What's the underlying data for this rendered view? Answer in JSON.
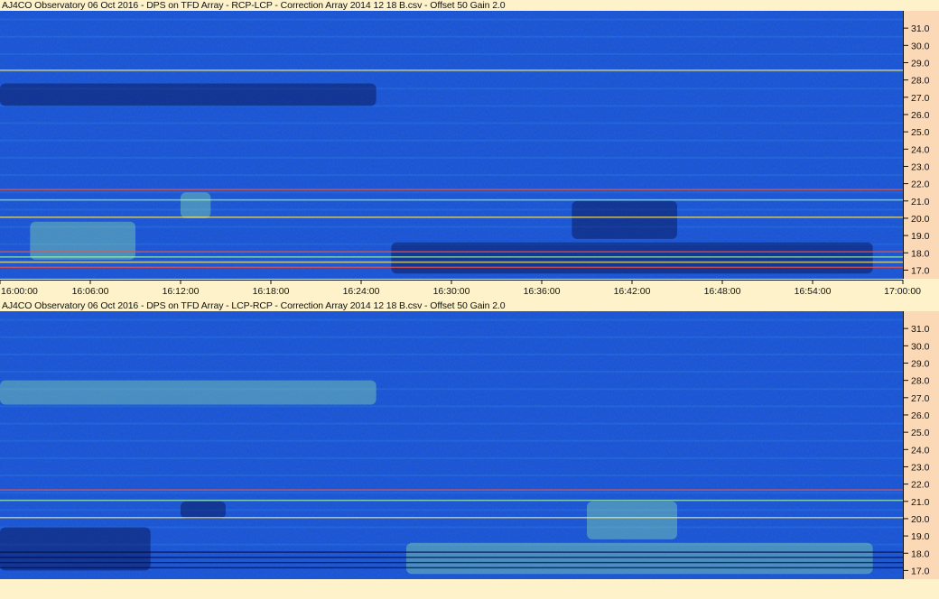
{
  "chart_data": [
    {
      "type": "heatmap",
      "title": "AJ4CO Observatory 06 Oct 2016 - DPS on TFD Array - RCP-LCP - Correction Array 2014 12 18 B.csv - Offset 50  Gain 2.0",
      "x_tick_labels": [
        "16:00:00",
        "16:06:00",
        "16:12:00",
        "16:18:00",
        "16:24:00",
        "16:30:00",
        "16:36:00",
        "16:42:00",
        "16:48:00",
        "16:54:00",
        "17:00:00"
      ],
      "y_tick_labels": [
        "17.0",
        "18.0",
        "19.0",
        "20.0",
        "21.0",
        "22.0",
        "23.0",
        "24.0",
        "25.0",
        "26.0",
        "27.0",
        "28.0",
        "29.0",
        "30.0",
        "31.0"
      ],
      "xlim": [
        "16:00:00",
        "17:00:00"
      ],
      "ylim": [
        16.5,
        32.0
      ],
      "colormap": [
        "#07104a",
        "#1a55d8",
        "#3fa0f0",
        "#9ef7a0",
        "#ffe860",
        "#ff5030"
      ],
      "dark_regions": [
        {
          "t_start": "16:00:00",
          "t_end": "16:25:00",
          "f_low": 26.5,
          "f_high": 27.8
        },
        {
          "t_start": "16:26:00",
          "t_end": "16:58:00",
          "f_low": 16.8,
          "f_high": 18.6
        },
        {
          "t_start": "16:38:00",
          "t_end": "16:45:00",
          "f_low": 18.8,
          "f_high": 21.0
        }
      ],
      "bright_regions": [
        {
          "t_start": "16:02:00",
          "t_end": "16:09:00",
          "f_low": 17.6,
          "f_high": 19.8
        },
        {
          "t_start": "16:12:00",
          "t_end": "16:14:00",
          "f_low": 20.0,
          "f_high": 21.5
        }
      ],
      "interference_lines_mhz": [
        17.2,
        17.5,
        17.8,
        18.1,
        20.1,
        21.1,
        21.7,
        28.6
      ]
    },
    {
      "type": "heatmap",
      "title": "AJ4CO Observatory 06 Oct 2016 - DPS on TFD Array - LCP-RCP - Correction Array 2014 12 18 B.csv - Offset 50  Gain 2.0",
      "x_tick_labels": [],
      "y_tick_labels": [
        "17.0",
        "18.0",
        "19.0",
        "20.0",
        "21.0",
        "22.0",
        "23.0",
        "24.0",
        "25.0",
        "26.0",
        "27.0",
        "28.0",
        "29.0",
        "30.0",
        "31.0"
      ],
      "xlim": [
        "16:00:00",
        "17:00:00"
      ],
      "ylim": [
        16.5,
        32.0
      ],
      "colormap": [
        "#07104a",
        "#1a55d8",
        "#3fa0f0",
        "#9ef7a0",
        "#ffe860",
        "#ff5030"
      ],
      "dark_regions": [
        {
          "t_start": "16:00:00",
          "t_end": "16:10:00",
          "f_low": 17.0,
          "f_high": 19.5
        },
        {
          "t_start": "16:12:00",
          "t_end": "16:15:00",
          "f_low": 20.0,
          "f_high": 21.0
        }
      ],
      "bright_regions": [
        {
          "t_start": "16:00:00",
          "t_end": "16:25:00",
          "f_low": 26.6,
          "f_high": 28.0
        },
        {
          "t_start": "16:27:00",
          "t_end": "16:58:00",
          "f_low": 16.8,
          "f_high": 18.6
        },
        {
          "t_start": "16:39:00",
          "t_end": "16:45:00",
          "f_low": 18.8,
          "f_high": 21.0
        }
      ],
      "interference_lines_mhz": [
        17.2,
        17.5,
        17.8,
        18.1,
        20.1,
        21.1,
        21.7
      ]
    }
  ]
}
